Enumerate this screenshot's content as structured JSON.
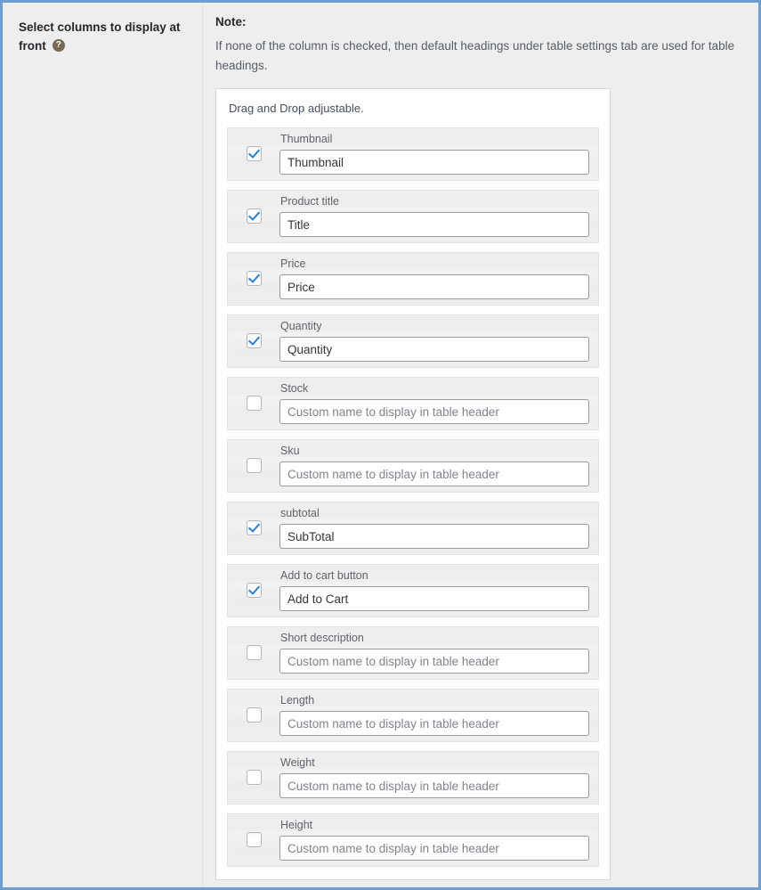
{
  "theme": {
    "frame_border": "#6f9fd0",
    "page_background": "#eeeeee",
    "panel_background": "#ffffff",
    "row_background": "#eeeeee",
    "accent_check": "#2a7fd4",
    "label_text": "#23282d",
    "muted_text": "#555e6a",
    "placeholder_text": "#7f858c"
  },
  "sidebar": {
    "field_label": "Select columns to display at front",
    "help_icon": "question-mark-circle-icon",
    "help_icon_glyph": "?"
  },
  "note": {
    "title": "Note:",
    "body": "If none of the column is checked, then default headings under table settings tab are used for table headings."
  },
  "panel": {
    "hint": "Drag and Drop adjustable.",
    "default_placeholder": "Custom name to display in table header",
    "columns": [
      {
        "name": "Thumbnail",
        "checked": true,
        "value": "Thumbnail",
        "placeholder": "Custom name to display in table header"
      },
      {
        "name": "Product title",
        "checked": true,
        "value": "Title",
        "placeholder": "Custom name to display in table header"
      },
      {
        "name": "Price",
        "checked": true,
        "value": "Price",
        "placeholder": "Custom name to display in table header"
      },
      {
        "name": "Quantity",
        "checked": true,
        "value": "Quantity",
        "placeholder": "Custom name to display in table header"
      },
      {
        "name": "Stock",
        "checked": false,
        "value": "",
        "placeholder": "Custom name to display in table header"
      },
      {
        "name": "Sku",
        "checked": false,
        "value": "",
        "placeholder": "Custom name to display in table header"
      },
      {
        "name": "subtotal",
        "checked": true,
        "value": "SubTotal",
        "placeholder": "Custom name to display in table header"
      },
      {
        "name": "Add to cart button",
        "checked": true,
        "value": "Add to Cart",
        "placeholder": "Custom name to display in table header"
      },
      {
        "name": "Short description",
        "checked": false,
        "value": "",
        "placeholder": "Custom name to display in table header"
      },
      {
        "name": "Length",
        "checked": false,
        "value": "",
        "placeholder": "Custom name to display in table header"
      },
      {
        "name": "Weight",
        "checked": false,
        "value": "",
        "placeholder": "Custom name to display in table header"
      },
      {
        "name": "Height",
        "checked": false,
        "value": "",
        "placeholder": "Custom name to display in table header"
      }
    ]
  }
}
